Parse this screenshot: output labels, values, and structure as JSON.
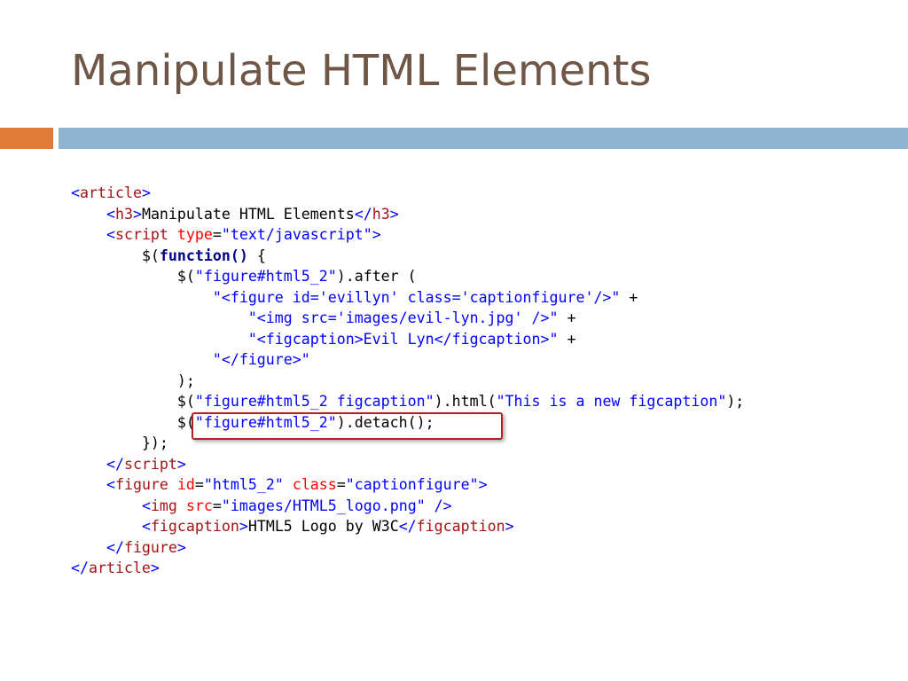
{
  "slide": {
    "title": "Manipulate HTML Elements"
  },
  "colors": {
    "title": "#6f5646",
    "accent_orange": "#e07b39",
    "accent_blue": "#8fb3cf",
    "highlight_box": "#b22222"
  },
  "code": {
    "l1": {
      "open": "<",
      "tag": "article",
      "close": ">"
    },
    "l2": {
      "indent": "    ",
      "open": "<",
      "tag": "h3",
      "close": ">",
      "text": "Manipulate HTML Elements",
      "end_open": "</",
      "end_tag": "h3",
      "end_close": ">"
    },
    "l3": {
      "indent": "    ",
      "open": "<",
      "tag": "script",
      "space": " ",
      "attr": "type",
      "eq": "=",
      "val": "\"text/javascript\"",
      "close": ">"
    },
    "l4": {
      "indent": "        ",
      "text1": "$(",
      "kw": "function()",
      "text2": " {"
    },
    "l5": {
      "indent": "            ",
      "text1": "$(",
      "str": "\"figure#html5_2\"",
      "text2": ").after ("
    },
    "l6": {
      "indent": "                ",
      "str": "\"<figure id='evillyn' class='captionfigure'/>\"",
      "text2": " +"
    },
    "l7": {
      "indent": "                    ",
      "str": "\"<img src='images/evil-lyn.jpg' />\"",
      "text2": " +"
    },
    "l8": {
      "indent": "                    ",
      "str": "\"<figcaption>Evil Lyn</figcaption>\"",
      "text2": " +"
    },
    "l9": {
      "indent": "                ",
      "str": "\"</figure>\""
    },
    "l10": {
      "indent": "            ",
      "text": ");"
    },
    "l11": {
      "indent": "            ",
      "text1": "$(",
      "str1": "\"figure#html5_2 figcaption\"",
      "text2": ").html(",
      "str2": "\"This is a new figcaption\"",
      "text3": ");"
    },
    "l12": {
      "indent": "            ",
      "text1": "$(",
      "str": "\"figure#html5_2\"",
      "text2": ").detach();"
    },
    "l13": {
      "indent": "        ",
      "text": "});"
    },
    "l14": {
      "indent": "    ",
      "open": "</",
      "tag": "script",
      "close": ">"
    },
    "l15": {
      "indent": "    ",
      "open": "<",
      "tag": "figure",
      "sp1": " ",
      "attr1": "id",
      "eq1": "=",
      "val1": "\"html5_2\"",
      "sp2": " ",
      "attr2": "class",
      "eq2": "=",
      "val2": "\"captionfigure\"",
      "close": ">"
    },
    "l16": {
      "indent": "        ",
      "open": "<",
      "tag": "img",
      "sp1": " ",
      "attr": "src",
      "eq": "=",
      "val": "\"images/HTML5_logo.png\"",
      "end": " />"
    },
    "l17": {
      "indent": "        ",
      "open": "<",
      "tag": "figcaption",
      "close": ">",
      "text": "HTML5 Logo by W3C",
      "end_open": "</",
      "end_tag": "figcaption",
      "end_close": ">"
    },
    "l18": {
      "indent": "    ",
      "open": "</",
      "tag": "figure",
      "close": ">"
    },
    "l19": {
      "open": "</",
      "tag": "article",
      "close": ">"
    }
  }
}
